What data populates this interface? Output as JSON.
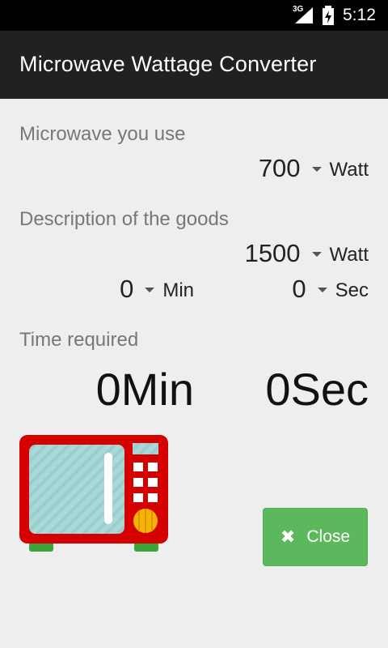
{
  "status_bar": {
    "network": "3G",
    "time": "5:12"
  },
  "app_bar": {
    "title": "Microwave Wattage Converter"
  },
  "microwave_use": {
    "label": "Microwave you use",
    "watt_value": "700",
    "watt_unit": "Watt"
  },
  "goods": {
    "label": "Description of the goods",
    "watt_value": "1500",
    "watt_unit": "Watt",
    "min_value": "0",
    "min_unit": "Min",
    "sec_value": "0",
    "sec_unit": "Sec"
  },
  "time_required": {
    "label": "Time required",
    "minutes": "0Min",
    "seconds": "0Sec"
  },
  "close_button": {
    "label": "Close",
    "icon": "close-x-icon"
  },
  "colors": {
    "appbar": "#212121",
    "button": "#5cb85c",
    "microwave_body": "#d50000"
  }
}
